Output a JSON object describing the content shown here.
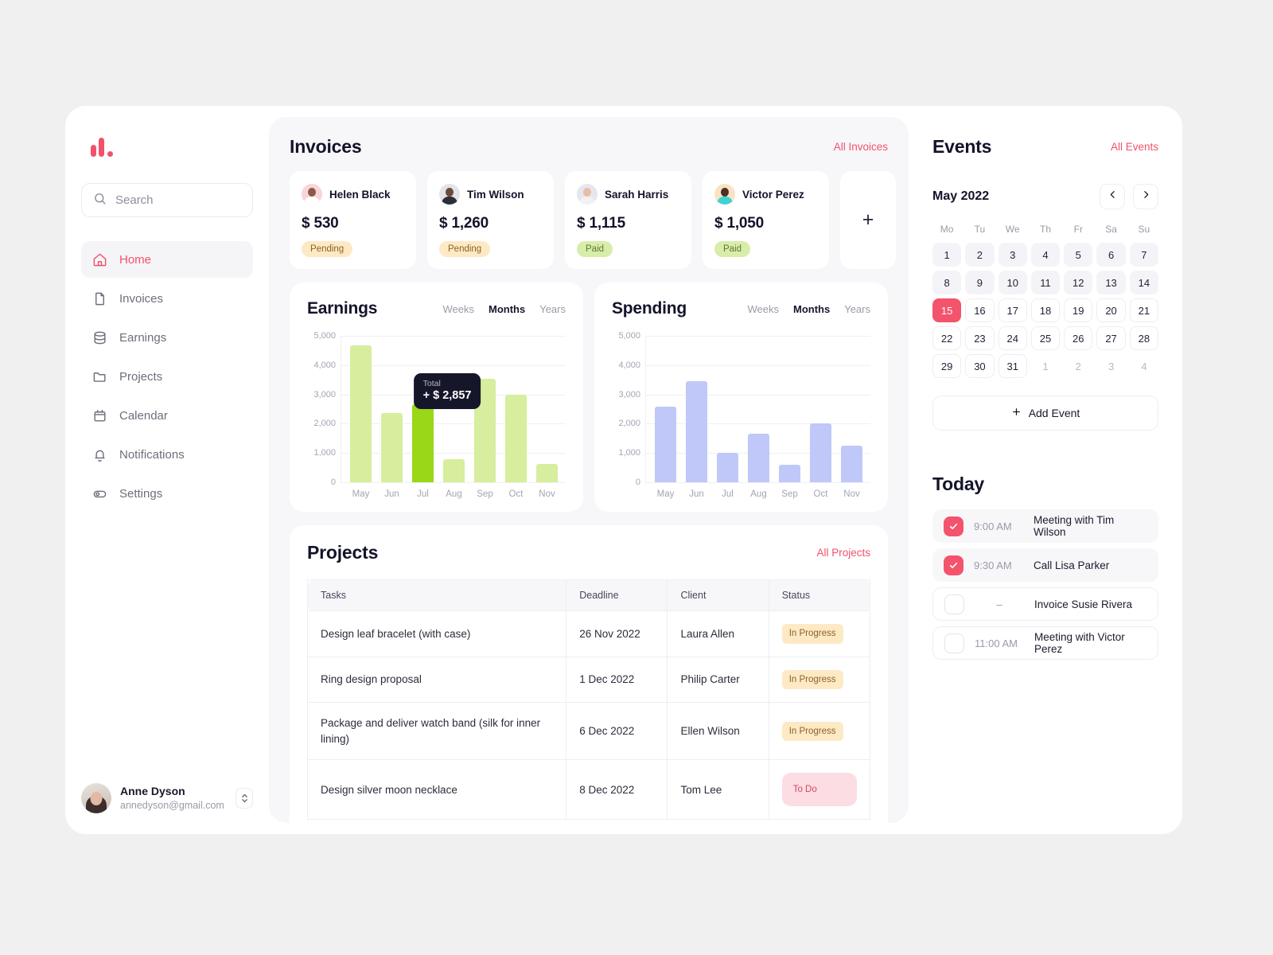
{
  "sidebar": {
    "logo_name": "logo",
    "search": {
      "placeholder": "Search",
      "value": ""
    },
    "items": [
      {
        "label": "Home",
        "icon": "home-icon",
        "active": true
      },
      {
        "label": "Invoices",
        "icon": "file-icon",
        "active": false
      },
      {
        "label": "Earnings",
        "icon": "database-icon",
        "active": false
      },
      {
        "label": "Projects",
        "icon": "folder-icon",
        "active": false
      },
      {
        "label": "Calendar",
        "icon": "calendar-icon",
        "active": false
      },
      {
        "label": "Notifications",
        "icon": "bell-icon",
        "active": false
      },
      {
        "label": "Settings",
        "icon": "toggle-icon",
        "active": false
      }
    ],
    "user": {
      "name": "Anne Dyson",
      "email": "annedyson@gmail.com"
    }
  },
  "invoices": {
    "title": "Invoices",
    "all_link": "All Invoices",
    "add_label": "+",
    "cards": [
      {
        "name": "Helen Black",
        "amount": "$ 530",
        "status": "Pending",
        "status_kind": "pending",
        "avatar": "av-helen"
      },
      {
        "name": "Tim Wilson",
        "amount": "$ 1,260",
        "status": "Pending",
        "status_kind": "pending",
        "avatar": "av-tim"
      },
      {
        "name": "Sarah Harris",
        "amount": "$ 1,115",
        "status": "Paid",
        "status_kind": "paid",
        "avatar": "av-sarah"
      },
      {
        "name": "Victor Perez",
        "amount": "$ 1,050",
        "status": "Paid",
        "status_kind": "paid",
        "avatar": "av-victor"
      }
    ]
  },
  "chart_data": [
    {
      "type": "bar",
      "title": "Earnings",
      "categories": [
        "May",
        "Jun",
        "Jul",
        "Aug",
        "Sep",
        "Oct",
        "Nov"
      ],
      "values": [
        4680,
        2360,
        2650,
        800,
        3530,
        3000,
        630
      ],
      "highlight_index": 2,
      "bar_color": "#d7ee9e",
      "highlight_color": "#9ad716",
      "xlabel": "",
      "ylabel": "",
      "ylim": [
        0,
        5000
      ],
      "yticks": [
        5000,
        4000,
        3000,
        2000,
        1000,
        0
      ],
      "ytick_labels": [
        "5,000",
        "4,000",
        "3,000",
        "2,000",
        "1,000",
        "0"
      ],
      "grid": true,
      "tabs": [
        "Weeks",
        "Months",
        "Years"
      ],
      "active_tab": "Months",
      "tooltip": {
        "label": "Total",
        "value": "+ $ 2,857",
        "at_category": "Jul"
      }
    },
    {
      "type": "bar",
      "title": "Spending",
      "categories": [
        "May",
        "Jun",
        "Jul",
        "Aug",
        "Sep",
        "Oct",
        "Nov"
      ],
      "values": [
        2580,
        3450,
        1000,
        1650,
        600,
        2000,
        1240
      ],
      "highlight_index": null,
      "bar_color": "#bfc8f8",
      "highlight_color": "#bfc8f8",
      "xlabel": "",
      "ylabel": "",
      "ylim": [
        0,
        5000
      ],
      "yticks": [
        5000,
        4000,
        3000,
        2000,
        1000,
        0
      ],
      "ytick_labels": [
        "5,000",
        "4,000",
        "3,000",
        "2,000",
        "1,000",
        "0"
      ],
      "grid": true,
      "tabs": [
        "Weeks",
        "Months",
        "Years"
      ],
      "active_tab": "Months",
      "tooltip": null
    }
  ],
  "projects": {
    "title": "Projects",
    "all_link": "All Projects",
    "columns": [
      "Tasks",
      "Deadline",
      "Client",
      "Status"
    ],
    "rows": [
      {
        "task": "Design leaf bracelet (with case)",
        "deadline": "26 Nov 2022",
        "client": "Laura Allen",
        "status": "In Progress",
        "status_kind": "inprogress"
      },
      {
        "task": "Ring design proposal",
        "deadline": "1 Dec 2022",
        "client": "Philip Carter",
        "status": "In Progress",
        "status_kind": "inprogress"
      },
      {
        "task": "Package and deliver watch band (silk for inner lining)",
        "deadline": "6 Dec 2022",
        "client": "Ellen Wilson",
        "status": "In Progress",
        "status_kind": "inprogress"
      },
      {
        "task": "Design silver moon necklace",
        "deadline": "8 Dec 2022",
        "client": "Tom Lee",
        "status": "To Do",
        "status_kind": "todo"
      }
    ]
  },
  "events": {
    "title": "Events",
    "all_link": "All Events",
    "month": "May 2022",
    "prev_label": "‹",
    "next_label": "›",
    "weekdays": [
      "Mo",
      "Tu",
      "We",
      "Th",
      "Fr",
      "Sa",
      "Su"
    ],
    "days": [
      {
        "n": "1",
        "kind": "past"
      },
      {
        "n": "2",
        "kind": "past"
      },
      {
        "n": "3",
        "kind": "past"
      },
      {
        "n": "4",
        "kind": "past"
      },
      {
        "n": "5",
        "kind": "past"
      },
      {
        "n": "6",
        "kind": "past"
      },
      {
        "n": "7",
        "kind": "past"
      },
      {
        "n": "8",
        "kind": "past"
      },
      {
        "n": "9",
        "kind": "past"
      },
      {
        "n": "10",
        "kind": "past"
      },
      {
        "n": "11",
        "kind": "past"
      },
      {
        "n": "12",
        "kind": "past"
      },
      {
        "n": "13",
        "kind": "past"
      },
      {
        "n": "14",
        "kind": "past"
      },
      {
        "n": "15",
        "kind": "today"
      },
      {
        "n": "16",
        "kind": "future"
      },
      {
        "n": "17",
        "kind": "future"
      },
      {
        "n": "18",
        "kind": "future"
      },
      {
        "n": "19",
        "kind": "future"
      },
      {
        "n": "20",
        "kind": "future"
      },
      {
        "n": "21",
        "kind": "future"
      },
      {
        "n": "22",
        "kind": "future"
      },
      {
        "n": "23",
        "kind": "future"
      },
      {
        "n": "24",
        "kind": "future"
      },
      {
        "n": "25",
        "kind": "future"
      },
      {
        "n": "26",
        "kind": "future"
      },
      {
        "n": "27",
        "kind": "future"
      },
      {
        "n": "28",
        "kind": "future"
      },
      {
        "n": "29",
        "kind": "future"
      },
      {
        "n": "30",
        "kind": "future"
      },
      {
        "n": "31",
        "kind": "future"
      },
      {
        "n": "1",
        "kind": "other"
      },
      {
        "n": "2",
        "kind": "other"
      },
      {
        "n": "3",
        "kind": "other"
      },
      {
        "n": "4",
        "kind": "other"
      }
    ],
    "add_event_label": "Add Event"
  },
  "today": {
    "title": "Today",
    "items": [
      {
        "time": "9:00 AM",
        "text": "Meeting with Tim Wilson",
        "done": true
      },
      {
        "time": "9:30 AM",
        "text": "Call Lisa Parker",
        "done": true
      },
      {
        "time": "–",
        "text": "Invoice Susie Rivera",
        "done": false
      },
      {
        "time": "11:00 AM",
        "text": "Meeting with Victor Perez",
        "done": false
      }
    ]
  },
  "colors": {
    "accent": "#f2516a",
    "today": "#f4536c",
    "earnings_bar": "#d7ee9e",
    "earnings_highlight": "#9ad716",
    "spending_bar": "#bfc8f8",
    "tooltip_bg": "#16162b"
  }
}
